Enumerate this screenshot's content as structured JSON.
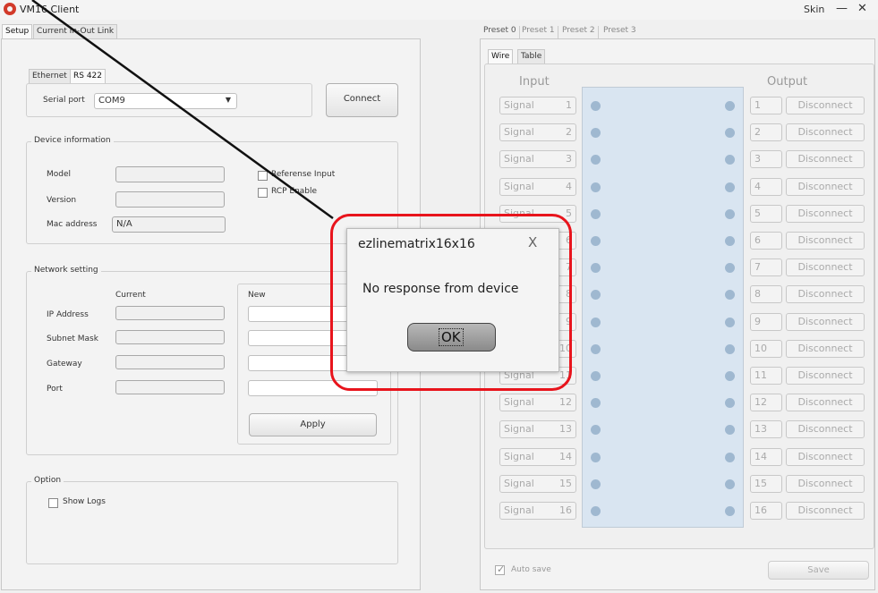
{
  "window": {
    "title": "VM16 Client",
    "skin_label": "Skin",
    "minimize_glyph": "—",
    "close_glyph": "✕"
  },
  "left_tabs": [
    "Setup",
    "Current In-Out Link"
  ],
  "setup": {
    "comm_tabs": [
      "Ethernet",
      "RS 422"
    ],
    "serial_port_label": "Serial port",
    "serial_port_value": "COM9",
    "connect_label": "Connect",
    "device_info": {
      "title": "Device information",
      "model_label": "Model",
      "version_label": "Version",
      "mac_label": "Mac address",
      "mac_value": "N/A",
      "reference_input_label": "Referense Input",
      "rcp_enable_label": "RCP Enable"
    },
    "network": {
      "title": "Network setting",
      "current_label": "Current",
      "new_label": "New",
      "ip_label": "IP Address",
      "subnet_label": "Subnet Mask",
      "gateway_label": "Gateway",
      "port_label": "Port",
      "apply_label": "Apply"
    },
    "option": {
      "title": "Option",
      "show_logs_label": "Show Logs"
    }
  },
  "presets": [
    "Preset 0",
    "Preset 1",
    "Preset 2",
    "Preset 3"
  ],
  "view_tabs": [
    "Wire",
    "Table"
  ],
  "wire": {
    "input_header": "Input",
    "output_header": "Output",
    "signal_label": "Signal",
    "disconnect_label": "Disconnect",
    "channels": [
      "1",
      "2",
      "3",
      "4",
      "5",
      "6",
      "7",
      "8",
      "9",
      "10",
      "11",
      "12",
      "13",
      "14",
      "15",
      "16"
    ]
  },
  "footer": {
    "autosave_label": "Auto save",
    "save_label": "Save"
  },
  "dialog": {
    "title": "ezlinematrix16x16",
    "message": "No response from device",
    "ok_label": "OK",
    "close_glyph": "X"
  },
  "colors": {
    "highlight": "#e8141c",
    "matrix_bg": "#d9e5f1",
    "app_icon": "#d23a2a"
  }
}
